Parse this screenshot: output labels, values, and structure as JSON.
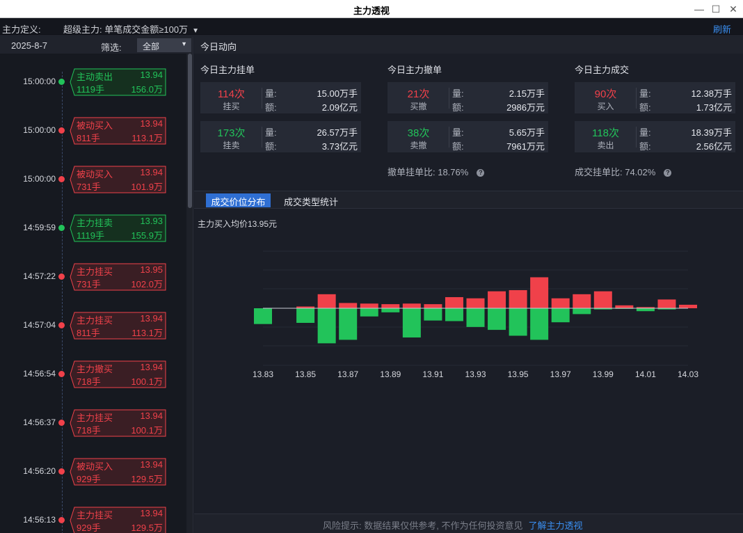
{
  "window": {
    "title": "主力透视"
  },
  "definition": {
    "label": "主力定义:",
    "value": "超级主力: 单笔成交金额≥100万",
    "refresh": "刷新"
  },
  "left": {
    "date": "2025-8-7",
    "filter_label": "筛选:",
    "filter_value": "全部",
    "trades": [
      {
        "time": "15:00:00",
        "type": "主动卖出",
        "price": "13.94",
        "volume": "1119手",
        "amount": "156.0万",
        "side": "sell"
      },
      {
        "time": "15:00:00",
        "type": "被动买入",
        "price": "13.94",
        "volume": "811手",
        "amount": "113.1万",
        "side": "buy"
      },
      {
        "time": "15:00:00",
        "type": "被动买入",
        "price": "13.94",
        "volume": "731手",
        "amount": "101.9万",
        "side": "buy"
      },
      {
        "time": "14:59:59",
        "type": "主力挂卖",
        "price": "13.93",
        "volume": "1119手",
        "amount": "155.9万",
        "side": "sell"
      },
      {
        "time": "14:57:22",
        "type": "主力挂买",
        "price": "13.95",
        "volume": "731手",
        "amount": "102.0万",
        "side": "buy"
      },
      {
        "time": "14:57:04",
        "type": "主力挂买",
        "price": "13.94",
        "volume": "811手",
        "amount": "113.1万",
        "side": "buy"
      },
      {
        "time": "14:56:54",
        "type": "主力撤买",
        "price": "13.94",
        "volume": "718手",
        "amount": "100.1万",
        "side": "buy"
      },
      {
        "time": "14:56:37",
        "type": "主力挂买",
        "price": "13.94",
        "volume": "718手",
        "amount": "100.1万",
        "side": "buy"
      },
      {
        "time": "14:56:20",
        "type": "被动买入",
        "price": "13.94",
        "volume": "929手",
        "amount": "129.5万",
        "side": "buy"
      },
      {
        "time": "14:56:13",
        "type": "主力挂买",
        "price": "13.94",
        "volume": "929手",
        "amount": "129.5万",
        "side": "buy"
      }
    ]
  },
  "today": {
    "header": "今日动向",
    "orders": {
      "title": "今日主力挂单",
      "buy": {
        "count": "114次",
        "label": "挂买",
        "k1": "量:",
        "v1": "15.00万手",
        "k2": "额:",
        "v2": "2.09亿元"
      },
      "sell": {
        "count": "173次",
        "label": "挂卖",
        "k1": "量:",
        "v1": "26.57万手",
        "k2": "额:",
        "v2": "3.73亿元"
      }
    },
    "cancels": {
      "title": "今日主力撤单",
      "buy": {
        "count": "21次",
        "label": "买撤",
        "k1": "量:",
        "v1": "2.15万手",
        "k2": "额:",
        "v2": "2986万元"
      },
      "sell": {
        "count": "38次",
        "label": "卖撤",
        "k1": "量:",
        "v1": "5.65万手",
        "k2": "额:",
        "v2": "7961万元"
      },
      "ratio": "撤单挂单比: 18.76%"
    },
    "deals": {
      "title": "今日主力成交",
      "buy": {
        "count": "90次",
        "label": "买入",
        "k1": "量:",
        "v1": "12.38万手",
        "k2": "额:",
        "v2": "1.73亿元"
      },
      "sell": {
        "count": "118次",
        "label": "卖出",
        "k1": "量:",
        "v1": "18.39万手",
        "k2": "额:",
        "v2": "2.56亿元"
      },
      "ratio": "成交挂单比: 74.02%"
    }
  },
  "tabs": {
    "active": "成交价位分布",
    "other": "成交类型统计"
  },
  "avg_price": "主力买入均价13.95元",
  "footer": {
    "text": "风险提示: 数据结果仅供参考, 不作为任何投资意见",
    "link": "了解主力透视"
  },
  "colors": {
    "buy": "#f0414a",
    "sell": "#22c35a",
    "link": "#3a8ef0",
    "tab_active": "#2f6fd3"
  },
  "chart_data": {
    "type": "bar",
    "x": [
      13.83,
      13.84,
      13.85,
      13.86,
      13.87,
      13.88,
      13.89,
      13.9,
      13.91,
      13.92,
      13.93,
      13.94,
      13.95,
      13.96,
      13.97,
      13.98,
      13.99,
      14.0,
      14.01,
      14.02,
      14.03
    ],
    "x_tick_labels": [
      "13.83",
      "13.85",
      "13.87",
      "13.89",
      "13.91",
      "13.93",
      "13.95",
      "13.97",
      "13.99",
      "14.01",
      "14.03"
    ],
    "series": [
      {
        "values": [
          0,
          0,
          3,
          24,
          9,
          8,
          7,
          8,
          7,
          19,
          17,
          29,
          31,
          53,
          17,
          24,
          29,
          5,
          2,
          15,
          6
        ]
      },
      {
        "values": [
          -27,
          0,
          -25,
          -60,
          -54,
          -14,
          -7,
          -50,
          -21,
          -22,
          -32,
          -37,
          -47,
          -54,
          -24,
          -10,
          -2,
          -1,
          -5,
          -2,
          0
        ]
      }
    ],
    "ylim": [
      -80,
      80
    ],
    "grid": true,
    "legend": "none"
  }
}
